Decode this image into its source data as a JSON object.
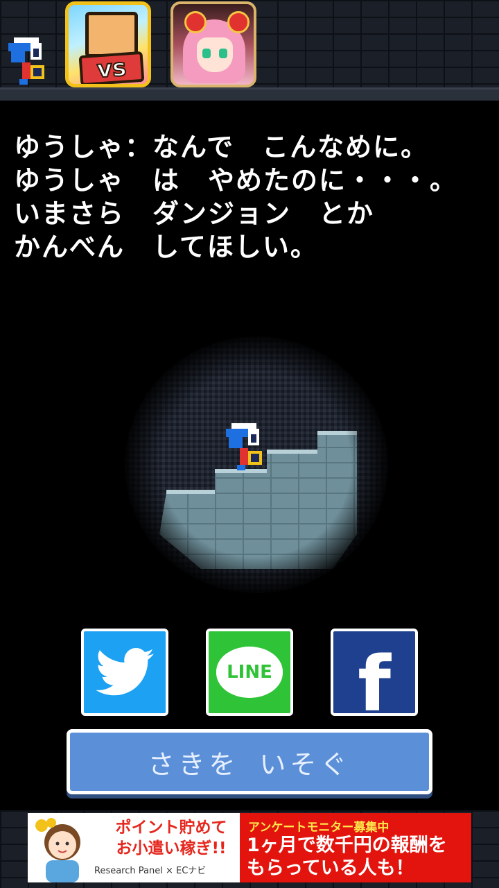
{
  "dialogue": {
    "lines": [
      "ゆうしゃ：なんで　こんなめに。",
      "ゆうしゃ　は　やめたのに・・・。",
      "いまさら　ダンジョン　とか",
      "かんべん　してほしい。"
    ]
  },
  "share": {
    "twitter_icon": "twitter-bird-icon",
    "line_label": "LINE",
    "facebook_label": "f"
  },
  "action": {
    "label": "さきを いそぐ"
  },
  "ad": {
    "headline": "ポイント貯めて お小遣い稼ぎ!!",
    "brand": "Research Panel × ECナビ",
    "kicker": "アンケートモニター募集中",
    "copy": "1ヶ月で数千円の報酬を もらっている人も！"
  },
  "colors": {
    "twitter": "#1da1f2",
    "line": "#2fc337",
    "facebook": "#1f3f8f",
    "action_button": "#5b8fd8",
    "ad_red": "#e3140e"
  }
}
